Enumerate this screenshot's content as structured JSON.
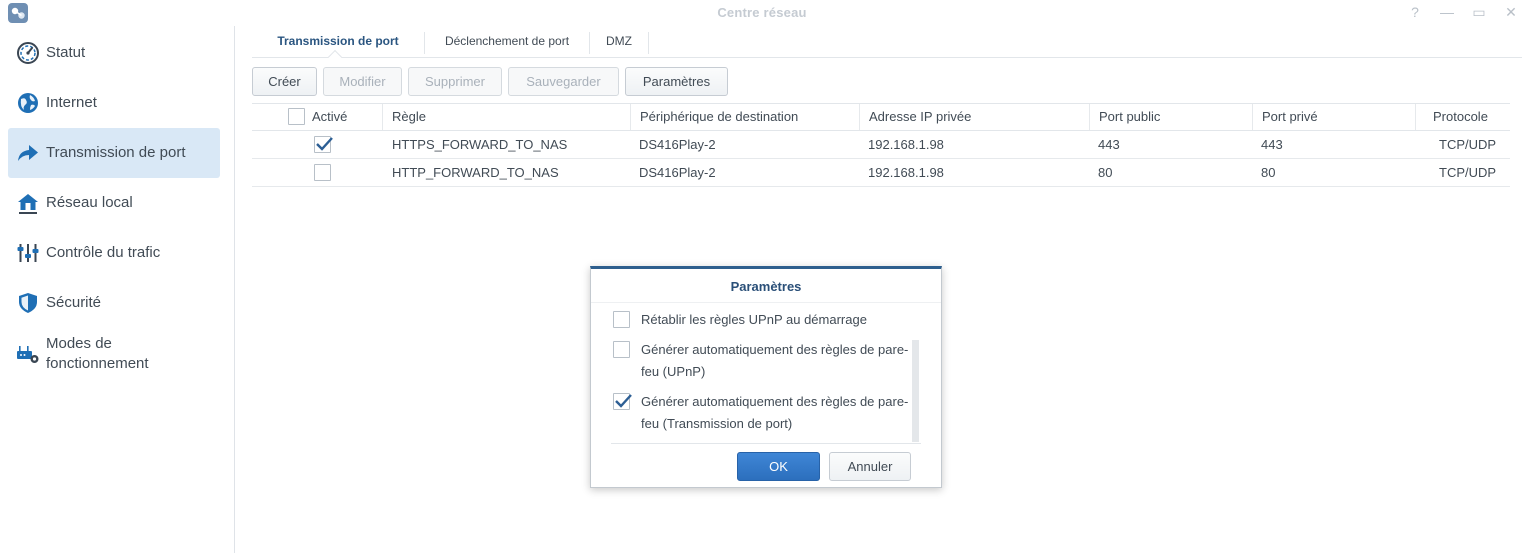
{
  "window": {
    "title": "Centre réseau",
    "controls": [
      "help-icon",
      "minimize-icon",
      "maximize-icon",
      "close-icon"
    ],
    "help_glyph": "?",
    "minimize_glyph": "—",
    "maximize_glyph": "▭",
    "close_glyph": "✕"
  },
  "sidebar": {
    "items": [
      {
        "label": "Statut",
        "icon": "gauge-icon"
      },
      {
        "label": "Internet",
        "icon": "globe-icon"
      },
      {
        "label": "Transmission de port",
        "icon": "forward-arrow-icon",
        "active": true
      },
      {
        "label": "Réseau local",
        "icon": "house-network-icon"
      },
      {
        "label": "Contrôle du trafic",
        "icon": "sliders-icon"
      },
      {
        "label": "Sécurité",
        "icon": "shield-icon"
      },
      {
        "label": "Modes de fonctionnement",
        "icon": "router-gear-icon"
      }
    ]
  },
  "tabs": [
    {
      "label": "Transmission de port",
      "active": true
    },
    {
      "label": "Déclenchement de port"
    },
    {
      "label": "DMZ"
    }
  ],
  "toolbar": {
    "create": "Créer",
    "edit": "Modifier",
    "delete": "Supprimer",
    "save": "Sauvegarder",
    "settings": "Paramètres"
  },
  "table": {
    "columns": [
      "Activé",
      "Règle",
      "Périphérique de destination",
      "Adresse IP privée",
      "Port public",
      "Port privé",
      "Protocole"
    ],
    "rows": [
      {
        "enabled": true,
        "rule": "HTTPS_FORWARD_TO_NAS",
        "device": "DS416Play-2",
        "ip": "192.168.1.98",
        "public_port": "443",
        "private_port": "443",
        "protocol": "TCP/UDP"
      },
      {
        "enabled": false,
        "rule": "HTTP_FORWARD_TO_NAS",
        "device": "DS416Play-2",
        "ip": "192.168.1.98",
        "public_port": "80",
        "private_port": "80",
        "protocol": "TCP/UDP"
      }
    ]
  },
  "dialog": {
    "title": "Paramètres",
    "options": [
      {
        "label": "Rétablir les règles UPnP au démarrage",
        "checked": false
      },
      {
        "label": "Générer automatiquement des règles de pare-feu (UPnP)",
        "checked": false
      },
      {
        "label": "Générer automatiquement des règles de pare-feu (Transmission de port)",
        "checked": true
      }
    ],
    "ok": "OK",
    "cancel": "Annuler"
  },
  "colors": {
    "accent": "#2e5f8e",
    "active_nav_bg": "#d9e8f6",
    "primary_button": "#2c6fbd",
    "icon_blue": "#1f6fb5"
  }
}
